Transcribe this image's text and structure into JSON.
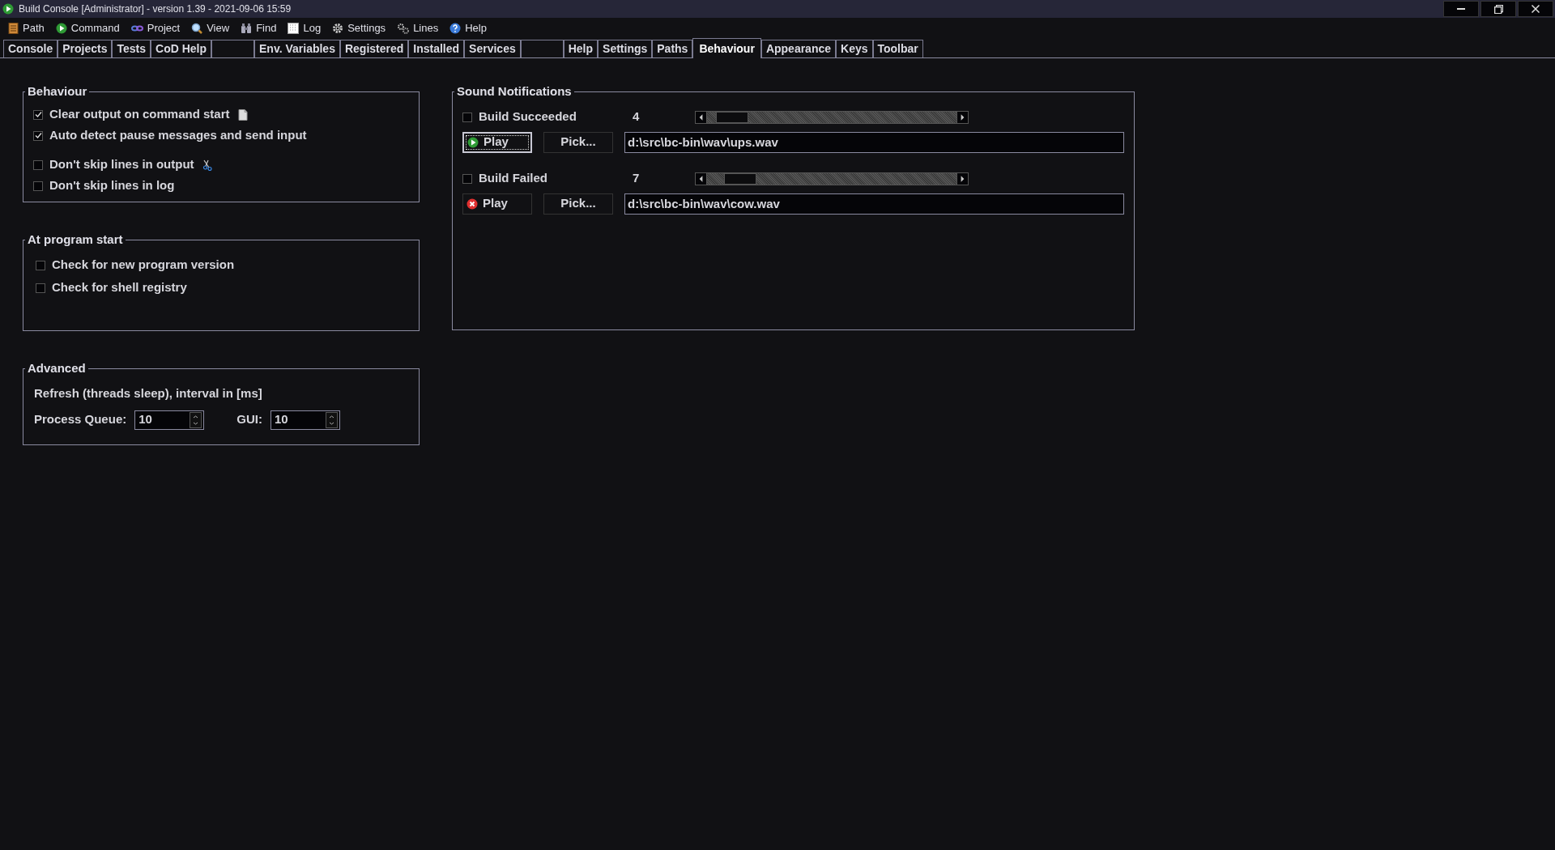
{
  "window": {
    "title": "Build Console [Administrator] - version 1.39 - 2021-09-06 15:59"
  },
  "menu": [
    {
      "label": "Path"
    },
    {
      "label": "Command"
    },
    {
      "label": "Project"
    },
    {
      "label": "View"
    },
    {
      "label": "Find"
    },
    {
      "label": "Log"
    },
    {
      "label": "Settings"
    },
    {
      "label": "Lines"
    },
    {
      "label": "Help"
    }
  ],
  "tabs": [
    {
      "label": "Console",
      "selected": false
    },
    {
      "label": "Projects",
      "selected": false
    },
    {
      "label": "Tests",
      "selected": false
    },
    {
      "label": "CoD Help",
      "selected": false
    },
    {
      "kind": "blank",
      "selected": false
    },
    {
      "label": "Env. Variables",
      "selected": false
    },
    {
      "label": "Registered",
      "selected": false
    },
    {
      "label": "Installed",
      "selected": false
    },
    {
      "label": "Services",
      "selected": false
    },
    {
      "kind": "blank",
      "selected": false
    },
    {
      "label": "Help",
      "selected": false
    },
    {
      "label": "Settings",
      "selected": false
    },
    {
      "label": "Paths",
      "selected": false
    },
    {
      "label": "Behaviour",
      "selected": true
    },
    {
      "label": "Appearance",
      "selected": false
    },
    {
      "label": "Keys",
      "selected": false
    },
    {
      "label": "Toolbar",
      "selected": false
    }
  ],
  "behaviour": {
    "title": "Behaviour",
    "options": [
      {
        "label": "Clear output on command start",
        "checked": true
      },
      {
        "label": "Auto detect pause messages and send input",
        "checked": true
      },
      {
        "label": "Don't skip lines in output",
        "checked": false
      },
      {
        "label": "Don't skip lines in log",
        "checked": false
      }
    ]
  },
  "at_program_start": {
    "title": "At program start",
    "options": [
      {
        "label": "Check for new program version",
        "checked": false
      },
      {
        "label": "Check for shell registry",
        "checked": false
      }
    ]
  },
  "advanced": {
    "title": "Advanced",
    "description": "Refresh (threads sleep), interval in [ms]",
    "fields": [
      {
        "label": "Process Queue:",
        "value": "10"
      },
      {
        "label": "GUI:",
        "value": "10"
      }
    ]
  },
  "sound_notifications": {
    "title": "Sound Notifications",
    "events": [
      {
        "label": "Build Succeeded",
        "checked": false,
        "volume": "4",
        "level": 0.04,
        "kind": "success",
        "play": "Play",
        "pick": "Pick...",
        "path": "d:\\src\\bc-bin\\wav\\ups.wav",
        "focused": true
      },
      {
        "label": "Build Failed",
        "checked": false,
        "volume": "7",
        "level": 0.08,
        "kind": "error",
        "play": "Play",
        "pick": "Pick...",
        "path": "d:\\src\\bc-bin\\wav\\cow.wav",
        "focused": false
      }
    ]
  }
}
